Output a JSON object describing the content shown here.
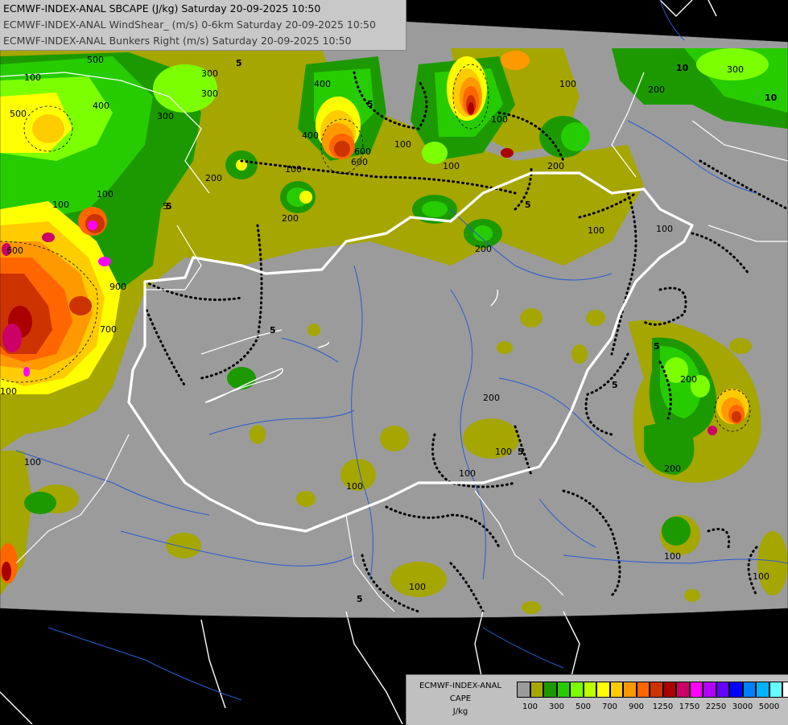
{
  "titles": [
    "ECMWF-INDEX-ANAL SBCAPE (J/kg) Saturday 20-09-2025 10:50",
    "ECMWF-INDEX-ANAL WindShear_ (m/s) 0-6km Saturday 20-09-2025 10:50",
    "ECMWF-INDEX-ANAL Bunkers Right (m/s) Saturday 20-09-2025 10:50"
  ],
  "legend": {
    "source": "ECMWF-INDEX-ANAL",
    "field": "CAPE",
    "unit": "J/kg",
    "colors": [
      "#9b9b9b",
      "#a6a600",
      "#1d9900",
      "#27cc00",
      "#7cff00",
      "#c0ff00",
      "#ffff00",
      "#ffcc00",
      "#ff9900",
      "#ff6600",
      "#cc3300",
      "#aa0000",
      "#cc0066",
      "#ff00ff",
      "#b300ff",
      "#6600ff",
      "#0000ff",
      "#0080ff",
      "#00b3ff",
      "#66ffff",
      "#ffffff"
    ],
    "tick_labels": [
      "100",
      "300",
      "500",
      "700",
      "900",
      "1250",
      "1750",
      "2250",
      "3000",
      "5000"
    ]
  },
  "map": {
    "contour_labels": [
      "500",
      "100",
      "400",
      "500",
      "300",
      "600",
      "100",
      "5",
      "300",
      "100",
      "700",
      "900",
      "200",
      "5",
      "100",
      "600",
      "400",
      "400",
      "5",
      "100",
      "100",
      "200",
      "100",
      "100",
      "5",
      "200",
      "100",
      "200",
      "5",
      "200",
      "5",
      "100",
      "100",
      "5",
      "100",
      "200",
      "100",
      "100",
      "5",
      "200",
      "100",
      "100",
      "100",
      "300",
      "5",
      "10",
      "5",
      "10",
      "300",
      "200",
      "600",
      "100"
    ]
  }
}
